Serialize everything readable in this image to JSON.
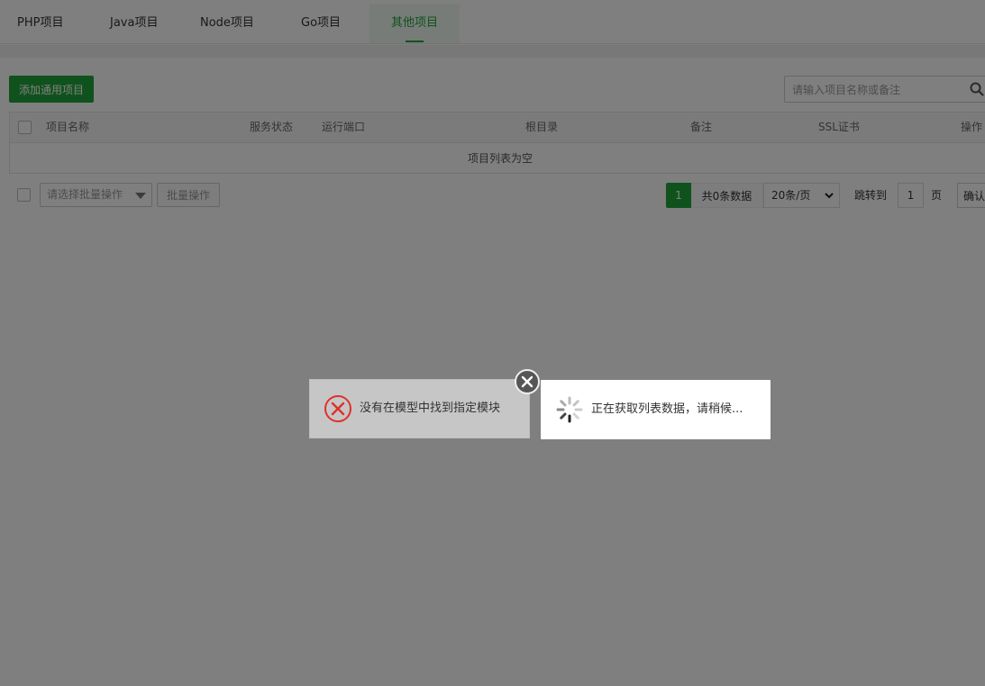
{
  "tabs": [
    {
      "label": "PHP项目"
    },
    {
      "label": "Java项目"
    },
    {
      "label": "Node项目"
    },
    {
      "label": "Go项目"
    },
    {
      "label": "其他项目",
      "active": true
    }
  ],
  "toolbar": {
    "add_label": "添加通用项目",
    "search_placeholder": "请输入项目名称或备注"
  },
  "table": {
    "columns": [
      "项目名称",
      "服务状态",
      "运行端口",
      "根目录",
      "备注",
      "SSL证书",
      "操作"
    ],
    "empty_text": "项目列表为空"
  },
  "batch": {
    "select_placeholder": "请选择批量操作",
    "button_label": "批量操作"
  },
  "pagination": {
    "current_page": "1",
    "total_text": "共0条数据",
    "page_size": "20条/页",
    "jump_label": "跳转到",
    "jump_value": "1",
    "page_suffix": "页",
    "confirm_label": "确认"
  },
  "dialogs": {
    "error_message": "没有在模型中找到指定模块",
    "loading_message": "正在获取列表数据，请稍候..."
  },
  "colors": {
    "accent": "#20a53a",
    "error": "#e0302a",
    "overlay": "rgba(0,0,0,0.5)"
  }
}
